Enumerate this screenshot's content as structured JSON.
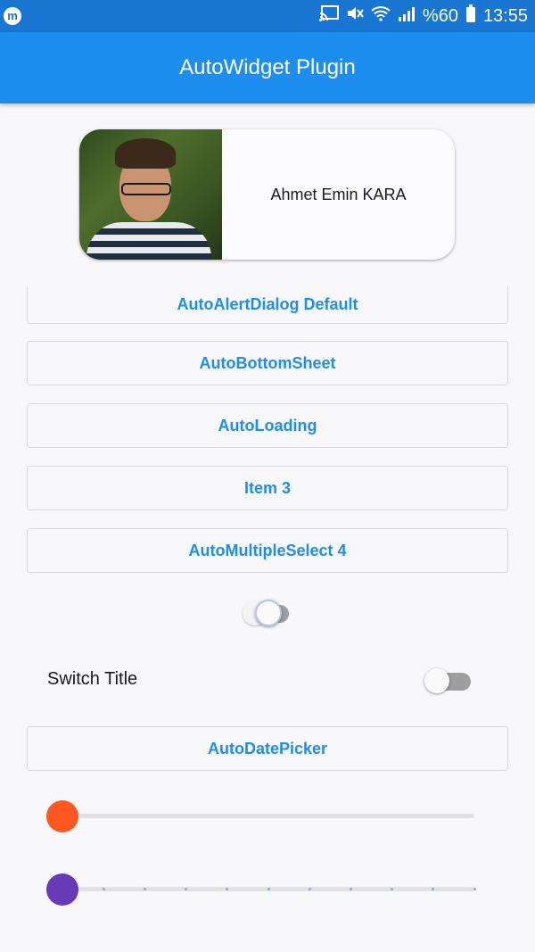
{
  "status_bar": {
    "app_icon": "m",
    "battery_percent": "%60",
    "time": "13:55",
    "icons": [
      "cast-icon",
      "mute-icon",
      "wifi-icon",
      "signal-icon",
      "battery-icon"
    ]
  },
  "app_bar": {
    "title": "AutoWidget Plugin",
    "color": "#1d8ef0"
  },
  "profile": {
    "name": "Ahmet Emin KARA"
  },
  "buttons": [
    {
      "label": "AutoAlertDialog Default"
    },
    {
      "label": "AutoBottomSheet"
    },
    {
      "label": "AutoLoading"
    },
    {
      "label": "Item 3"
    },
    {
      "label": "AutoMultipleSelect 4"
    }
  ],
  "center_switch": {
    "on": false
  },
  "switch_tile": {
    "title": "Switch Title",
    "on": false
  },
  "date_picker_button": {
    "label": "AutoDatePicker"
  },
  "sliders": [
    {
      "value": 0,
      "color": "#ff5722",
      "divisions": 0
    },
    {
      "value": 0,
      "color": "#673ab7",
      "divisions": 10
    }
  ]
}
